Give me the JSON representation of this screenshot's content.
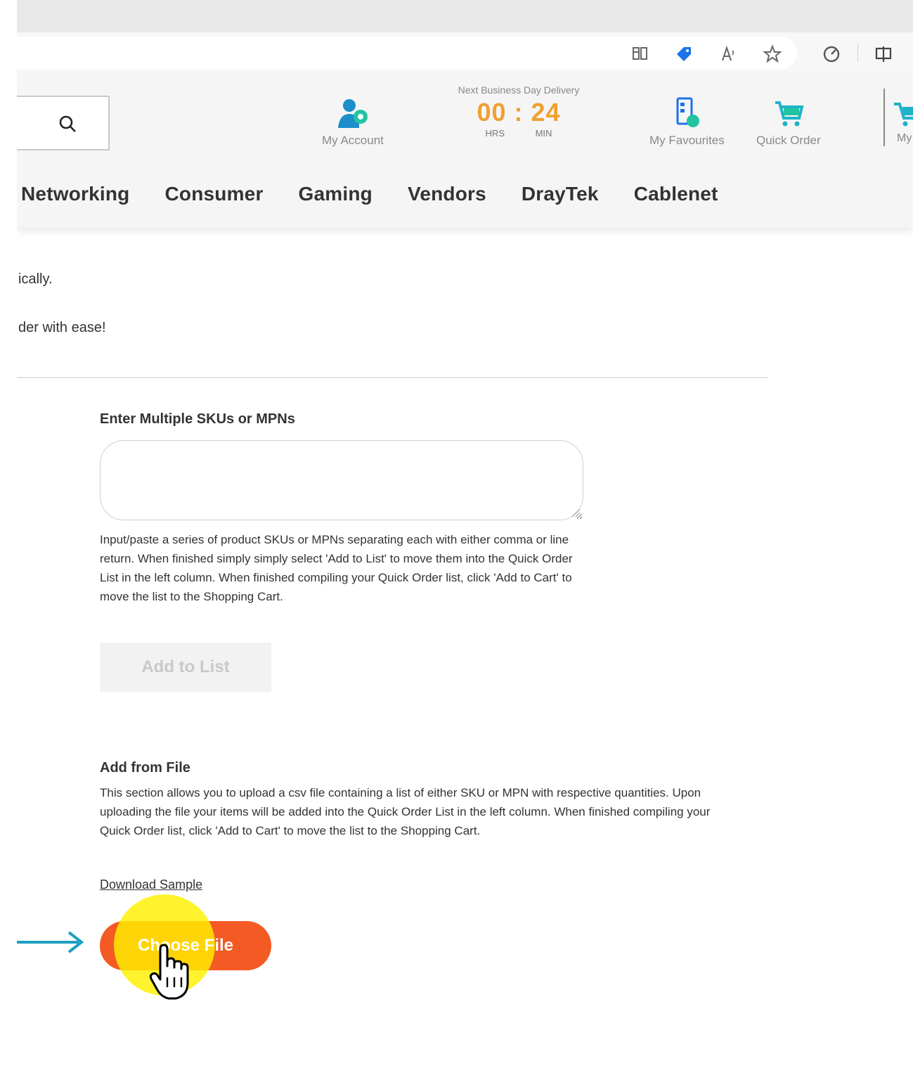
{
  "header": {
    "account_label": "My Account",
    "delivery_title": "Next Business Day Delivery",
    "timer": "00 : 24",
    "timer_units": "HRS MIN",
    "favourites_label": "My Favourites",
    "quick_order_label": "Quick Order",
    "cart_label_fragment": "My"
  },
  "nav": {
    "items": [
      "Networking",
      "Consumer",
      "Gaming",
      "Vendors",
      "DrayTek",
      "Cablenet"
    ]
  },
  "intro": {
    "line1": "ically.",
    "line2": "der with ease!"
  },
  "multi_sku": {
    "title": "Enter Multiple SKUs or MPNs",
    "textarea_value": "",
    "help": "Input/paste a series of product SKUs or MPNs separating each with either comma or line return. When finished simply simply select 'Add to List' to move them into the Quick Order List in the left column. When finished compiling your Quick Order list, click 'Add to Cart' to move the list to the Shopping Cart.",
    "add_button": "Add to List"
  },
  "file_upload": {
    "title": "Add from File",
    "help": "This section allows you to upload a csv file containing a list of either SKU or MPN with respective quantities. Upon uploading the file your items will be added into the Quick Order List in the left column. When finished compiling your Quick Order list, click 'Add to Cart' to move the list to the Shopping Cart.",
    "download_link": "Download Sample",
    "choose_button": "Choose File"
  },
  "colors": {
    "accent_orange": "#f45a23",
    "timer_orange": "#f0a030",
    "icon_teal": "#20b2c8",
    "icon_blue": "#1a73e8",
    "highlight_yellow": "#fff000"
  }
}
